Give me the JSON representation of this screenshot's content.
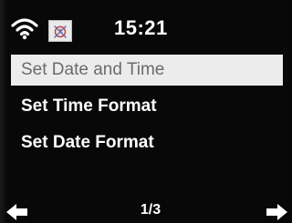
{
  "status_bar": {
    "time": "15:21",
    "wifi_icon": "wifi-icon",
    "alarm_icon": "alarm-clock-icon"
  },
  "menu": {
    "items": [
      {
        "label": "Set Date and Time",
        "selected": true
      },
      {
        "label": "Set Time Format",
        "selected": false
      },
      {
        "label": "Set Date Format",
        "selected": false
      }
    ]
  },
  "footer": {
    "page": "1/3",
    "left_icon": "arrow-left-icon",
    "right_icon": "arrow-right-icon"
  },
  "colors": {
    "background": "#080808",
    "text": "#ffffff",
    "selected_bg": "#ececec",
    "selected_text": "#6b6b6b"
  }
}
